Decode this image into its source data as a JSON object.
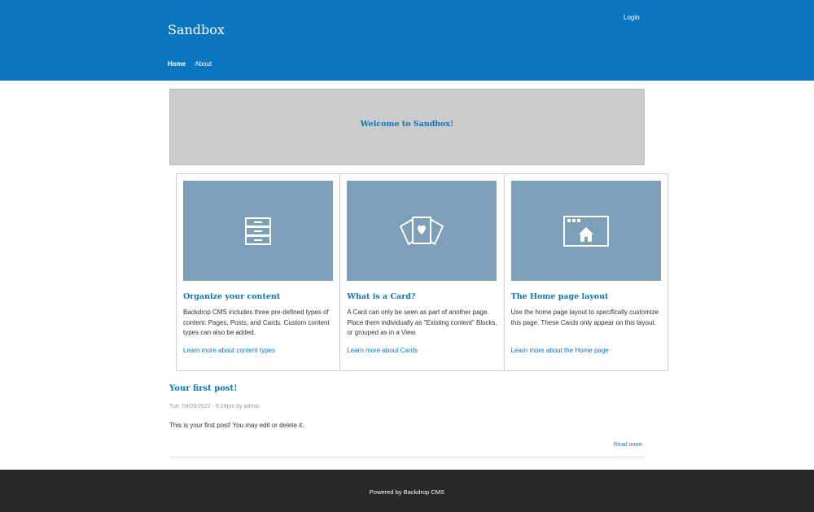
{
  "header": {
    "site_name": "Sandbox",
    "login": "Login",
    "nav": [
      {
        "label": "Home",
        "active": true
      },
      {
        "label": "About",
        "active": false
      }
    ],
    "background_color": "#0a76bf"
  },
  "hero": {
    "title": "Welcome to Sandbox!"
  },
  "cards": [
    {
      "icon": "filing-cabinet-icon",
      "title": "Organize your content",
      "body": "Backdrop CMS includes three pre-defined types of content: Pages, Posts, and Cards. Custom content types can also be added.",
      "link": "Learn more about content types"
    },
    {
      "icon": "cards-heart-icon",
      "title": "What is a Card?",
      "body": "A Card can only be seen as part of another page. Place them individually as \"Existing content\" Blocks, or grouped as in a View.",
      "link": "Learn more about Cards"
    },
    {
      "icon": "browser-home-icon",
      "title": "The Home page layout",
      "body": "Use the home page layout to specifically customize this page. These Cards only appear on this layout.",
      "link": "Learn more about the Home page"
    }
  ],
  "post": {
    "title": "Your first post!",
    "date": "Tue, 04/26/2022 - 6:24pm",
    "by": "by",
    "author": "admin",
    "body": "This is your first post! You may edit or delete it.",
    "read_more": "Read more"
  },
  "footer": {
    "powered_by": "Powered by",
    "link": "Backdrop CMS"
  }
}
